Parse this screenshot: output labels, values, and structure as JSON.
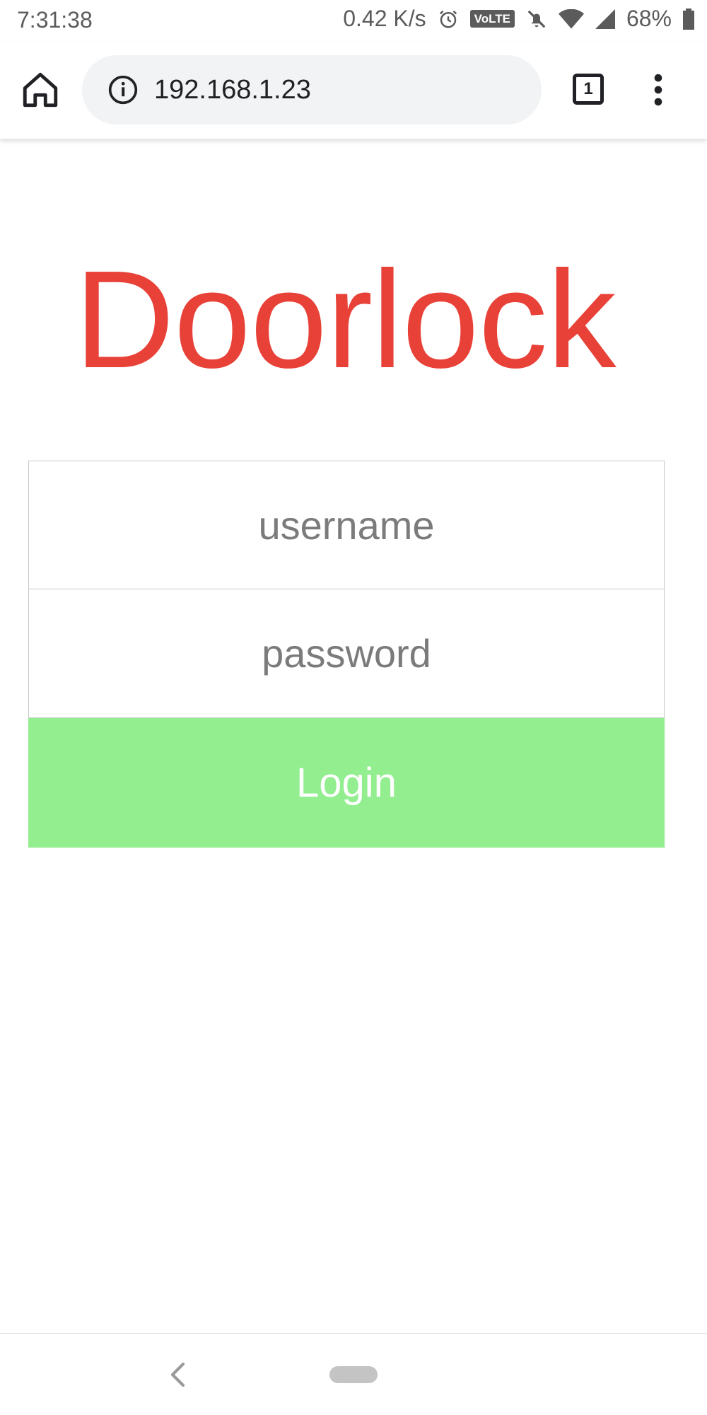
{
  "status_bar": {
    "time": "7:31:38",
    "network_speed": "0.42 K/s",
    "volte_label": "VoLTE",
    "battery_percent": "68%",
    "icons": [
      "alarm-icon",
      "volte-icon",
      "bell-off-icon",
      "wifi-icon",
      "signal-icon",
      "battery-icon"
    ]
  },
  "browser": {
    "url": "192.168.1.23",
    "tab_count": "1",
    "icons": [
      "home-icon",
      "info-icon",
      "tabs-icon",
      "more-vert-icon"
    ]
  },
  "page": {
    "title": "Doorlock",
    "username_placeholder": "username",
    "password_placeholder": "password",
    "username_value": "",
    "password_value": "",
    "login_label": "Login"
  },
  "colors": {
    "title": "#e84138",
    "login_button": "#92ee8e",
    "login_text": "#ffffff",
    "omnibox": "#f1f3f4",
    "field_border": "#c8c8c8",
    "placeholder": "#7b7b7b"
  },
  "nav_bar": {
    "icons": [
      "back-icon",
      "home-pill"
    ]
  }
}
